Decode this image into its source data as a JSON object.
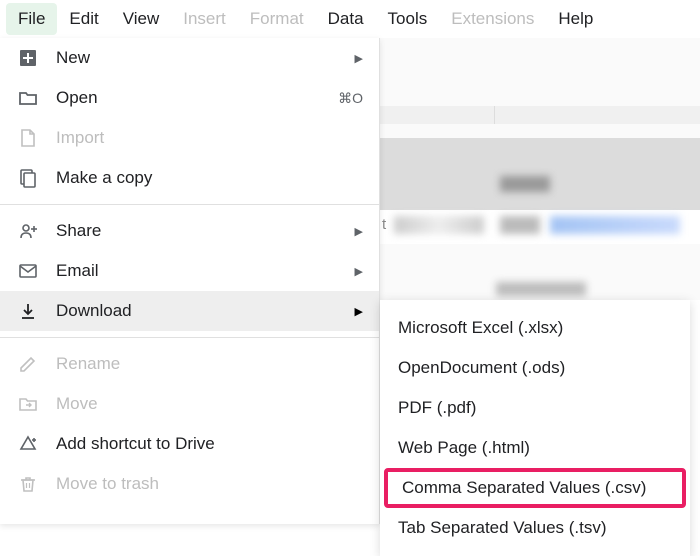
{
  "menubar": {
    "file": "File",
    "edit": "Edit",
    "view": "View",
    "insert": "Insert",
    "format": "Format",
    "data": "Data",
    "tools": "Tools",
    "extensions": "Extensions",
    "help": "Help"
  },
  "file_menu": {
    "new": "New",
    "open": "Open",
    "open_shortcut": "⌘O",
    "import": "Import",
    "make_copy": "Make a copy",
    "share": "Share",
    "email": "Email",
    "download": "Download",
    "rename": "Rename",
    "move": "Move",
    "add_shortcut": "Add shortcut to Drive",
    "move_trash": "Move to trash"
  },
  "download_menu": {
    "xlsx": "Microsoft Excel (.xlsx)",
    "ods": "OpenDocument (.ods)",
    "pdf": "PDF (.pdf)",
    "html": "Web Page (.html)",
    "csv": "Comma Separated Values (.csv)",
    "tsv": "Tab Separated Values (.tsv)"
  },
  "bg": {
    "t": "t"
  }
}
